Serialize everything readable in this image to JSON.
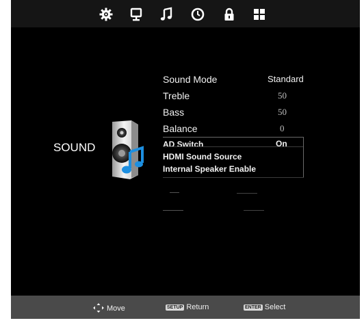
{
  "tabs": [
    {
      "icon": "picture-settings-icon"
    },
    {
      "icon": "monitor-icon"
    },
    {
      "icon": "music-note-icon"
    },
    {
      "icon": "clock-icon"
    },
    {
      "icon": "lock-icon"
    },
    {
      "icon": "grid-icon"
    }
  ],
  "section": {
    "title": "SOUND",
    "icon": "speaker-music-icon"
  },
  "menu": [
    {
      "label": "Sound Mode",
      "value": "Standard"
    },
    {
      "label": "Treble",
      "value": "50"
    },
    {
      "label": "Bass",
      "value": "50"
    },
    {
      "label": "Balance",
      "value": "0"
    },
    {
      "label": "AD Switch",
      "value": "On"
    },
    {
      "label": "HDMI Sound Source",
      "value": ""
    },
    {
      "label": "Internal Speaker Enable",
      "value": ""
    }
  ],
  "footer": {
    "move": {
      "label": "Move",
      "icon": "dpad-arrows-icon"
    },
    "return": {
      "key": "SETUP",
      "label": "Return"
    },
    "select": {
      "key": "ENTER",
      "label": "Select"
    }
  },
  "colors": {
    "background": "#000000",
    "topbar": "#151515",
    "footer": "#4a4a4a",
    "text": "#f2f2f2"
  }
}
